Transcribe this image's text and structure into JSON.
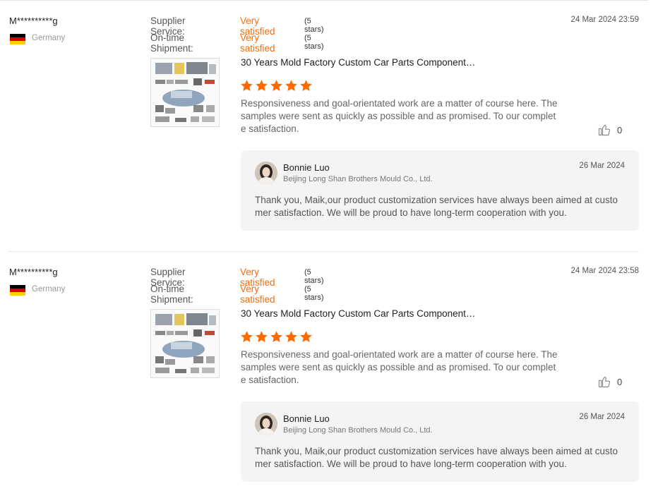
{
  "reviews": [
    {
      "buyer_name": "M**********g",
      "country": "Germany",
      "ratings": [
        {
          "label": "Supplier Service:",
          "value": "Very satisfied",
          "stars": "(5 stars)"
        },
        {
          "label": "On-time Shipment:",
          "value": "Very satisfied",
          "stars": "(5 stars)"
        }
      ],
      "date": "24 Mar 2024 23:59",
      "product_title": "30 Years Mold Factory Custom Car Parts Component…",
      "star_rating": 5,
      "text": "Responsiveness and goal-orientated work are a matter of course here. The samples were sent as quickly as possible and as promised. To our complete satisfaction.",
      "likes": "0",
      "reply": {
        "name": "Bonnie Luo",
        "company": "Beijing Long Shan Brothers Mould Co., Ltd.",
        "date": "26 Mar 2024",
        "text": "Thank you, Maik,our product customization services have always been aimed at customer satisfaction. We will be proud to have long-term cooperation with you."
      }
    },
    {
      "buyer_name": "M**********g",
      "country": "Germany",
      "ratings": [
        {
          "label": "Supplier Service:",
          "value": "Very satisfied",
          "stars": "(5 stars)"
        },
        {
          "label": "On-time Shipment:",
          "value": "Very satisfied",
          "stars": "(5 stars)"
        }
      ],
      "date": "24 Mar 2024 23:58",
      "product_title": "30 Years Mold Factory Custom Car Parts Component…",
      "star_rating": 5,
      "text": "Responsiveness and goal-orientated work are a matter of course here. The samples were sent as quickly as possible and as promised. To our complete satisfaction.",
      "likes": "0",
      "reply": {
        "name": "Bonnie Luo",
        "company": "Beijing Long Shan Brothers Mould Co., Ltd.",
        "date": "26 Mar 2024",
        "text": "Thank you, Maik,our product customization services have always been aimed at customer satisfaction. We will be proud to have long-term cooperation with you."
      }
    }
  ],
  "colors": {
    "accent": "#ff6a00",
    "reply_bg": "#f4f4f4"
  },
  "icons": {
    "like": "thumbs-up-icon",
    "star": "star-icon",
    "flag": "germany-flag-icon"
  }
}
